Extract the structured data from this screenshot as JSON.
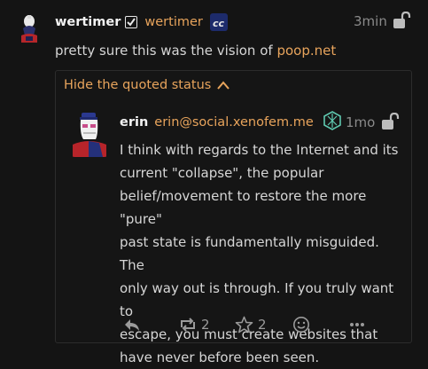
{
  "post": {
    "display_name": "wertimer",
    "handle": "wertimer",
    "time": "3min",
    "text_prefix": "pretty sure this was the vision of ",
    "link_text": "poop.net"
  },
  "quote": {
    "toggle_label": "Hide the quoted status",
    "display_name": "erin",
    "handle": "erin@social.xenofem.me",
    "time": "1mo",
    "lines": [
      "I think with regards to the Internet and its",
      "current \"collapse\", the popular",
      "belief/movement to restore the more \"pure\"",
      "past state is fundamentally misguided. The",
      "only way out is through. If you truly want to",
      "escape, you must create websites that",
      "have never before been seen."
    ],
    "repeat_count": "2",
    "favorite_count": "2"
  },
  "colors": {
    "accent": "#e8a45c",
    "background": "#141414",
    "text": "#d6d6d6"
  },
  "icons": {
    "post_badges": [
      "checkmark-badge-icon",
      "cc-badge-icon"
    ],
    "quote_badge": "hexagon-emblem-icon",
    "visibility": "lock-open-icon",
    "actions": [
      "reply-icon",
      "repeat-icon",
      "star-icon",
      "emoji-react-icon",
      "more-icon"
    ]
  }
}
